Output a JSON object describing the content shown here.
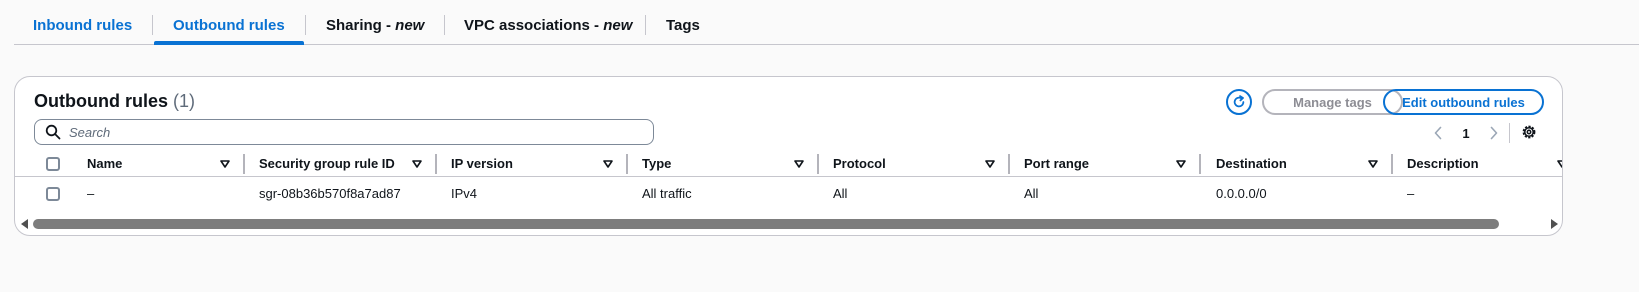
{
  "tabs": [
    {
      "label": "Inbound rules",
      "suffix": ""
    },
    {
      "label": "Outbound rules",
      "suffix": ""
    },
    {
      "label": "Sharing - ",
      "suffix": "new"
    },
    {
      "label": "VPC associations - ",
      "suffix": "new"
    },
    {
      "label": "Tags",
      "suffix": ""
    }
  ],
  "panel": {
    "title": "Outbound rules",
    "count": "(1)",
    "manage_tags_label": "Manage tags",
    "edit_label": "Edit outbound rules"
  },
  "search": {
    "placeholder": "Search",
    "value": ""
  },
  "pagination": {
    "current_page": "1"
  },
  "table": {
    "columns": [
      "Name",
      "Security group rule ID",
      "IP version",
      "Type",
      "Protocol",
      "Port range",
      "Destination",
      "Description"
    ],
    "rows": [
      {
        "name": "–",
        "rule_id": "sgr-08b36b570f8a7ad87",
        "ip_version": "IPv4",
        "type": "All traffic",
        "protocol": "All",
        "port_range": "All",
        "destination": "0.0.0.0/0",
        "description": "–"
      }
    ]
  },
  "icons": {
    "refresh": "refresh-icon",
    "search": "search-icon",
    "prev": "chevron-left-icon",
    "next": "chevron-right-icon",
    "settings": "gear-icon",
    "sort": "sort-caret-icon"
  },
  "colors": {
    "accent": "#0972d3",
    "text": "#0f141a",
    "muted": "#5f6b7a",
    "border": "#c6c6cd",
    "disabled": "#8d8d94",
    "background": "#fafafa"
  }
}
